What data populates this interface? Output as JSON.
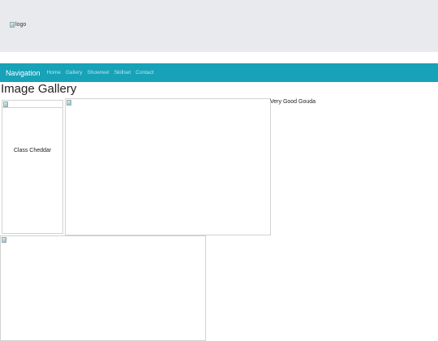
{
  "header": {
    "logo_alt": "logo"
  },
  "navbar": {
    "brand": "Navigation",
    "links": [
      "Home",
      "Gallery",
      "Showreel",
      "Skillset",
      "Contact"
    ],
    "background": "#17a2b8",
    "link_color": "#b8e6ee"
  },
  "gallery": {
    "title": "Image Gallery",
    "images": [
      {
        "alt": "Class Cheddar"
      },
      {
        "alt": ""
      },
      {
        "alt": "Very Good Gouda"
      },
      {
        "alt": ""
      }
    ]
  }
}
